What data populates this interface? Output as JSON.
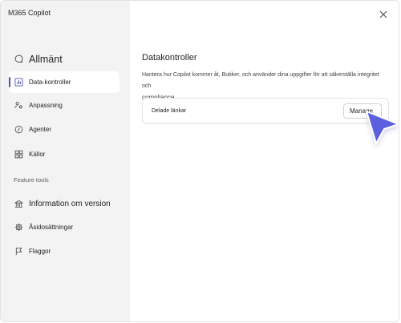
{
  "app": {
    "title": "M365 Copilot"
  },
  "sidebar": {
    "items": [
      {
        "label": "Allmänt"
      },
      {
        "label": "Data-kontroller"
      },
      {
        "label": "Anpassning"
      },
      {
        "label": "Agenter"
      },
      {
        "label": "Källor"
      }
    ],
    "section_label": "Feature tools",
    "tools": [
      {
        "label": "Information om version"
      },
      {
        "label": "Åsidosättningar"
      },
      {
        "label": "Flaggor"
      }
    ]
  },
  "main": {
    "title": "Datakontroller",
    "description_line1": "Hantera hur Copilot kommer åt, Butiker, och använder dina uppgifter för att säkerställa integritet och",
    "description_line2": "compliance.",
    "card": {
      "label": "Delade länkar",
      "button_label": "Manage"
    }
  },
  "colors": {
    "accent": "#4f52b2",
    "cursor": "#5b5fe0",
    "sidebar_bg": "#f3f3f3"
  }
}
